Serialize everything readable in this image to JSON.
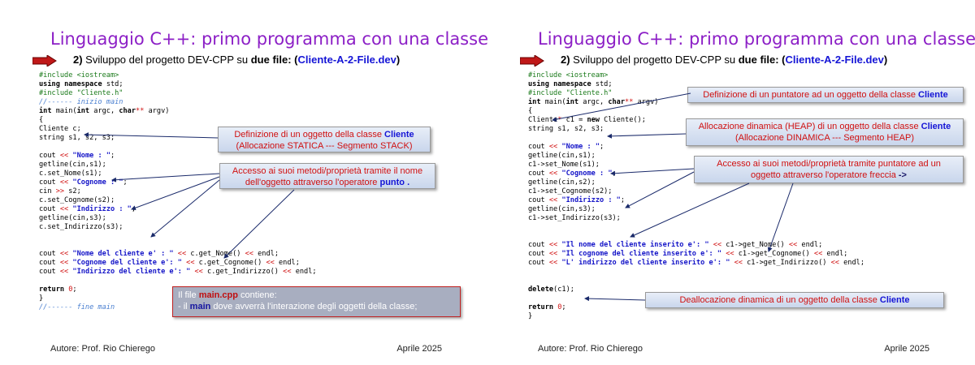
{
  "slides": [
    {
      "title": "Linguaggio C++: primo programma con una classe",
      "subtitle": {
        "num": "2)",
        "text": " Sviluppo del progetto DEV-CPP su ",
        "bold": "due file",
        "sep": ": (",
        "file": "Cliente-A-2-File.dev",
        "end": ")"
      },
      "code": [
        "#include <iostream>",
        "using namespace std;",
        "#include \"Cliente.h\"",
        "//------ inizio main",
        "int main(int argc, char** argv)",
        "{",
        "Cliente c;",
        "string s1, s2, s3;",
        "",
        "cout << \"Nome : \";",
        "getline(cin,s1);",
        "c.set_Nome(s1);",
        "cout << \"Cognome : \";",
        "cin >> s2;",
        "c.set_Cognome(s2);",
        "cout << \"Indirizzo : \";",
        "getline(cin,s3);",
        "c.set_Indirizzo(s3);",
        "",
        "",
        "cout << \"Nome del cliente e' : \" << c.get_Nome() << endl;",
        "cout << \"Cognome del cliente e': \" << c.get_Cognome() << endl;",
        "cout << \"Indirizzo del cliente e': \" << c.get_Indirizzo() << endl;",
        "",
        "return 0;",
        "}",
        "//------ fine main"
      ],
      "box1": {
        "line1": "Definizione di un oggetto della classe ",
        "cls": "Cliente",
        "line2": "(Allocazione STATICA --- Segmento STACK)"
      },
      "box2": {
        "line1": "Accesso ai suoi metodi/proprietà tramite il nome",
        "line2": "dell'oggetto attraverso l'operatore ",
        "kw": "punto ."
      },
      "box3": {
        "pre": "Il file ",
        "file": "main.cpp",
        "post": " contiene:",
        "line2pre": "- il ",
        "main": "main",
        "line2post": " dove avverrà l'interazione degli oggetti della classe;"
      },
      "author": "Autore: Prof. Rio Chierego",
      "date": "Aprile 2025"
    },
    {
      "title": "Linguaggio C++: primo programma con una classe",
      "subtitle": {
        "num": "2)",
        "text": " Sviluppo del progetto DEV-CPP su ",
        "bold": "due file",
        "sep": ": (",
        "file": "Cliente-A-2-File.dev",
        "end": ")"
      },
      "code": [
        "#include <iostream>",
        "using namespace std;",
        "#include \"Cliente.h\"",
        "int main(int argc, char** argv)",
        "{",
        "Cliente* c1 = new Cliente();",
        "string s1, s2, s3;",
        "",
        "cout << \"Nome : \";",
        "getline(cin,s1);",
        "c1->set_Nome(s1);",
        "cout << \"Cognome : \";",
        "getline(cin,s2);",
        "c1->set_Cognome(s2);",
        "cout << \"Indirizzo : \";",
        "getline(cin,s3);",
        "c1->set_Indirizzo(s3);",
        "",
        "",
        "cout << \"Il nome del cliente inserito e': \" << c1->get_Nome() << endl;",
        "cout << \"Il cognome del cliente inserito e': \" << c1->get_Cognome() << endl;",
        "cout << \"L' indirizzo del cliente inserito e': \" << c1->get_Indirizzo() << endl;",
        "",
        "",
        "delete(c1);",
        "",
        "return 0;",
        "}"
      ],
      "box1": {
        "line1": "Definizione di un puntatore ad un oggetto della classe ",
        "cls": "Cliente"
      },
      "box2": {
        "line1": "Allocazione dinamica (HEAP) di un oggetto della classe ",
        "cls": "Cliente",
        "line2": "(Allocazione DINAMICA --- Segmento HEAP)"
      },
      "box3": {
        "line1": "Accesso ai suoi metodi/proprietà tramite puntatore ad un",
        "line2": "oggetto attraverso l'operatore freccia ",
        "kw": "->"
      },
      "box4": {
        "line1": "Deallocazione dinamica di un oggetto della classe ",
        "cls": "Cliente"
      },
      "author": "Autore: Prof. Rio Chierego",
      "date": "Aprile 2025"
    }
  ],
  "colors": {
    "title": "#8c1fc6",
    "accent_blue": "#1515d6",
    "accent_red": "#d01010"
  }
}
